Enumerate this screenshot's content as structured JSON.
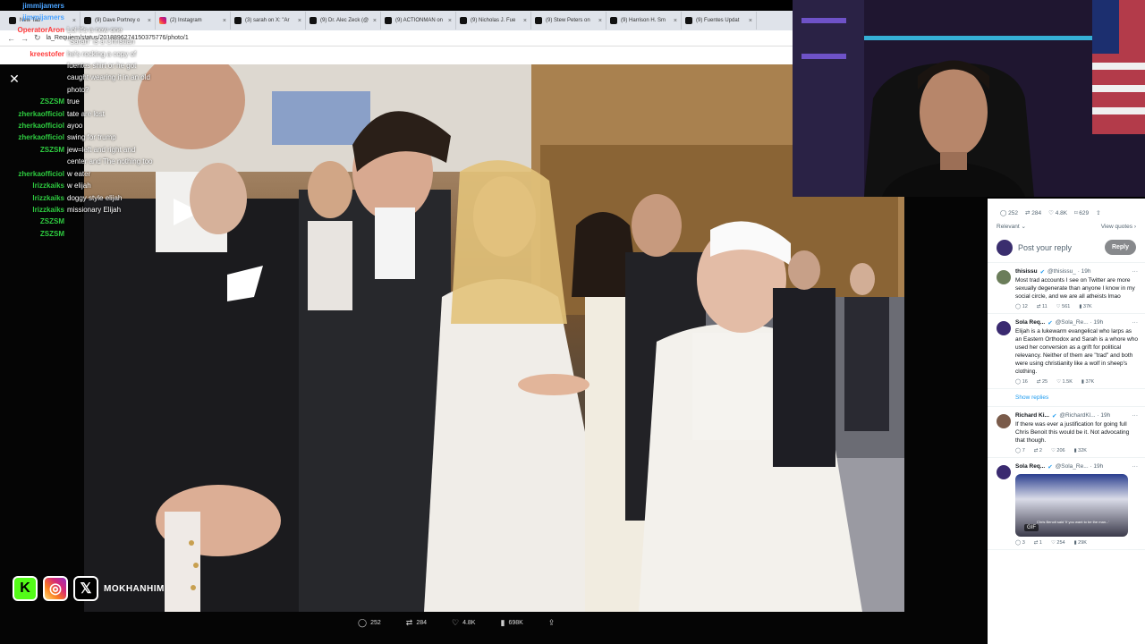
{
  "browser": {
    "tabs": [
      {
        "label": "New Tab",
        "icon": "x-icon"
      },
      {
        "label": "(9) Dave Portnoy o",
        "icon": "x-icon"
      },
      {
        "label": "(2) Instagram",
        "icon": "instagram-icon"
      },
      {
        "label": "(3) sarah on X: \"Ar",
        "icon": "x-icon"
      },
      {
        "label": "(9) Dr. Alec Zeck (@",
        "icon": "x-icon"
      },
      {
        "label": "(9) ACTIONMAN on",
        "icon": "x-icon"
      },
      {
        "label": "(9) Nicholas J. Fue",
        "icon": "x-icon"
      },
      {
        "label": "(9) Stew Peters on",
        "icon": "x-icon"
      },
      {
        "label": "(9) Harrison H. Sm",
        "icon": "x-icon"
      },
      {
        "label": "(9) Fuentes Updat",
        "icon": "x-icon"
      }
    ],
    "url": "la_Requiem/status/2018896274150375776/photo/1"
  },
  "chat": [
    {
      "user": "jimmijamers",
      "text": "",
      "color": "#4aa3ff"
    },
    {
      "user": "jimmijamers",
      "text": "",
      "color": "#4aa3ff"
    },
    {
      "user": "OperatorAron",
      "text": "Lol it's a new one",
      "color": "#ff3b3b"
    },
    {
      "user": "",
      "text": "\"Sarah\" is a Christian",
      "color": "#fff"
    },
    {
      "user": "kreestofer",
      "text": "he's rocking a copy of",
      "color": "#ff3b3b"
    },
    {
      "user": "",
      "text": "fuentes shirt or he got",
      "color": "#fff"
    },
    {
      "user": "",
      "text": "caught wearing it in an old",
      "color": "#fff"
    },
    {
      "user": "",
      "text": "photo?",
      "color": "#fff"
    },
    {
      "user": "ZSZSM",
      "text": "true",
      "color": "#2ecc40"
    },
    {
      "user": "zherkaofficiol",
      "text": "tate are lost",
      "color": "#2ecc40"
    },
    {
      "user": "zherkaofficiol",
      "text": "ayoo",
      "color": "#2ecc40"
    },
    {
      "user": "zherkaofficiol",
      "text": "swing for trump",
      "color": "#2ecc40"
    },
    {
      "user": "ZSZSM",
      "text": "jew=left and right and",
      "color": "#2ecc40"
    },
    {
      "user": "",
      "text": "center and The nothing too",
      "color": "#fff"
    },
    {
      "user": "",
      "text": "",
      "color": "#fff"
    },
    {
      "user": "zherkaofficiol",
      "text": "w eater",
      "color": "#2ecc40"
    },
    {
      "user": "lrizzkaiks",
      "text": "w elijah",
      "color": "#2ecc40"
    },
    {
      "user": "lrizzkaiks",
      "text": "doggy style elijah",
      "color": "#2ecc40"
    },
    {
      "user": "lrizzkaiks",
      "text": "missionary Elijah",
      "color": "#2ecc40"
    },
    {
      "user": "ZSZSM",
      "text": "",
      "color": "#2ecc40"
    },
    {
      "user": "ZSZSM",
      "text": "",
      "color": "#2ecc40"
    }
  ],
  "viewer": {
    "close_icon": "close-icon",
    "actions": {
      "replies": "252",
      "reposts": "284",
      "likes": "4.8K",
      "views": "698K"
    }
  },
  "sidebar": {
    "stats": {
      "replies": "252",
      "reposts": "284",
      "likes": "4.8K",
      "bookmarks": "629"
    },
    "sort_label": "Relevant",
    "quotes_label": "View quotes",
    "reply_placeholder": "Post your reply",
    "reply_button": "Reply",
    "replies": [
      {
        "name": "thisissu",
        "handle": "@thisissu_ · 19h",
        "text": "Most trad accounts I see on Twitter are more sexually degenerate than anyone I know in my social circle, and we are all atheists lmao",
        "stats": {
          "replies": "12",
          "reposts": "11",
          "likes": "561",
          "views": "37K"
        }
      },
      {
        "name": "Sola Req...",
        "handle": "@Sola_Re... · 19h",
        "text": "Elijah is a lukewarm evangelical who larps as an Eastern Orthodox and Sarah is a whore who used her conversion as a grift for political relevancy. Neither of them are \"trad\" and both were using christianity like a wolf in sheep's clothing.",
        "stats": {
          "replies": "16",
          "reposts": "25",
          "likes": "1.5K",
          "views": "37K"
        }
      },
      {
        "name": "Richard Ki...",
        "handle": "@RichardKl... · 19h",
        "text": "If there was ever a justification for going full Chris Benoit this would be it. Not advocating that though.",
        "stats": {
          "replies": "7",
          "reposts": "2",
          "likes": "206",
          "views": "32K"
        }
      },
      {
        "name": "Sola Req...",
        "handle": "@Sola_Re... · 19h",
        "text": "",
        "gif_caption": "Chris Benoit said 'If you want to be the man...'",
        "gif_badge": "GIF",
        "stats": {
          "replies": "3",
          "reposts": "1",
          "likes": "254",
          "views": "29K"
        }
      }
    ],
    "show_replies": "Show replies"
  },
  "socials": {
    "handle": "MOKHANHIM"
  }
}
